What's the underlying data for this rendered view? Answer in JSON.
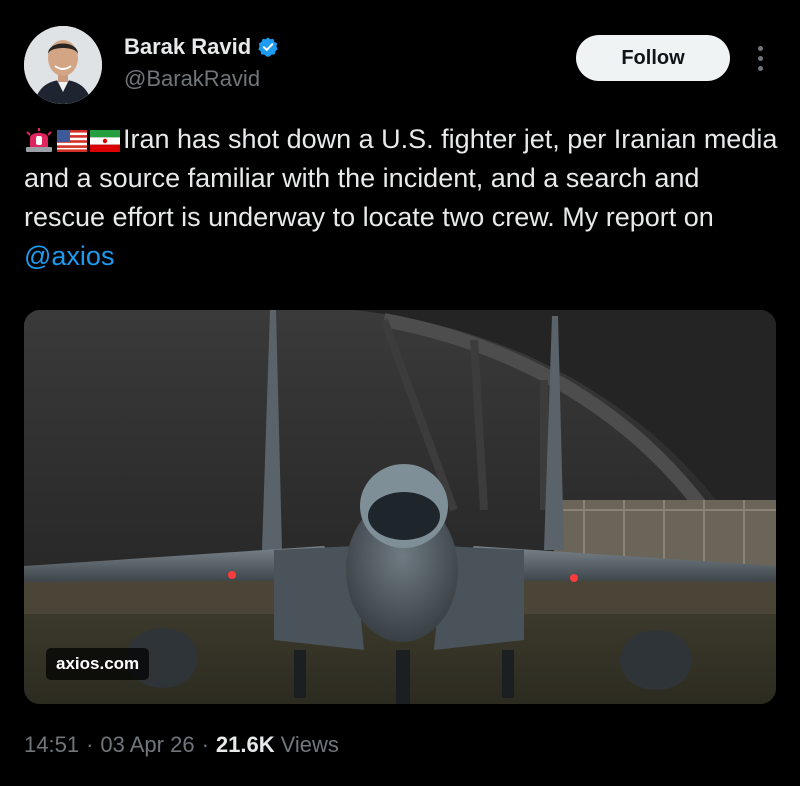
{
  "author": {
    "name": "Barak Ravid",
    "handle": "@BarakRavid",
    "verified_color": "#1d9bf0"
  },
  "header": {
    "follow_label": "Follow",
    "more_icon": "more-vertical-icon"
  },
  "tweet": {
    "emojis": [
      "rotating-light",
      "us-flag",
      "iran-flag"
    ],
    "text": "Iran has shot down a U.S. fighter jet, per Iranian media and a source familiar with the incident, and a search and rescue effort is underway to locate two crew. My report on ",
    "mention": "@axios"
  },
  "media": {
    "source_label": "axios.com"
  },
  "meta": {
    "time": "14:51",
    "separator": "·",
    "date": "03 Apr 26",
    "views_count": "21.6K",
    "views_label": "Views"
  },
  "colors": {
    "background": "#000000",
    "text": "#e7e9ea",
    "muted": "#71767b",
    "link": "#1d9bf0"
  }
}
